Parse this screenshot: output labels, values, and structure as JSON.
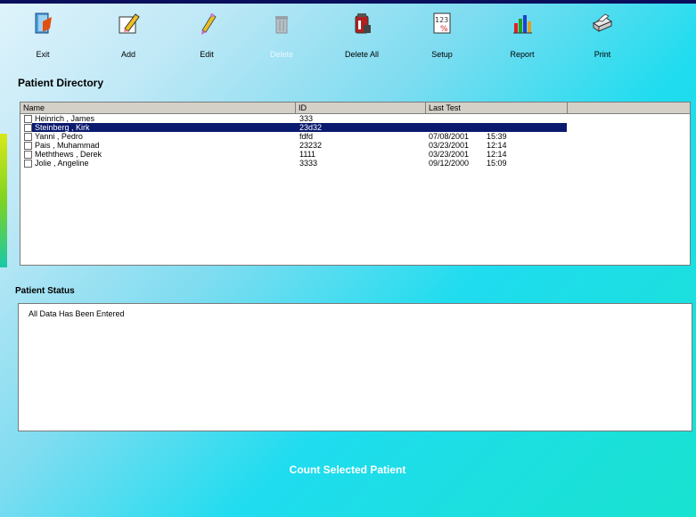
{
  "toolbar": {
    "exit": {
      "label": "Exit",
      "icon": "exit-door-icon"
    },
    "add": {
      "label": "Add",
      "icon": "add-pencil-icon"
    },
    "edit": {
      "label": "Edit",
      "icon": "edit-pen-icon"
    },
    "delete": {
      "label": "Delete",
      "icon": "trash-can-icon"
    },
    "delete_all": {
      "label": "Delete All",
      "icon": "delete-all-bin-icon"
    },
    "setup": {
      "label": "Setup",
      "icon": "setup-calculator-icon"
    },
    "report": {
      "label": "Report",
      "icon": "report-chart-icon"
    },
    "print": {
      "label": "Print",
      "icon": "printer-icon"
    }
  },
  "directory": {
    "title": "Patient Directory",
    "columns": [
      "Name",
      "ID",
      "Last Test"
    ],
    "rows": [
      {
        "name": "Heinrich , James",
        "id": "333",
        "date": "",
        "time": "",
        "selected": false
      },
      {
        "name": "Steinberg , Kirk",
        "id": "23d32",
        "date": "",
        "time": "",
        "selected": true
      },
      {
        "name": "Yanni , Pedro",
        "id": "fdfd",
        "date": "07/08/2001",
        "time": "15:39",
        "selected": false
      },
      {
        "name": "Pais , Muhammad",
        "id": "23232",
        "date": "03/23/2001",
        "time": "12:14",
        "selected": false
      },
      {
        "name": "Meththews , Derek",
        "id": "1111",
        "date": "03/23/2001",
        "time": "12:14",
        "selected": false
      },
      {
        "name": "Jolie , Angeline",
        "id": "3333",
        "date": "09/12/2000",
        "time": "15:09",
        "selected": false
      }
    ]
  },
  "status": {
    "title": "Patient Status",
    "text": "All Data Has Been Entered"
  },
  "count_button": {
    "label": "Count Selected Patient"
  },
  "colors": {
    "selection": "#0a1a6e",
    "titlebar": "#0a0f5c",
    "bg_cyan": "#1fdcef"
  }
}
